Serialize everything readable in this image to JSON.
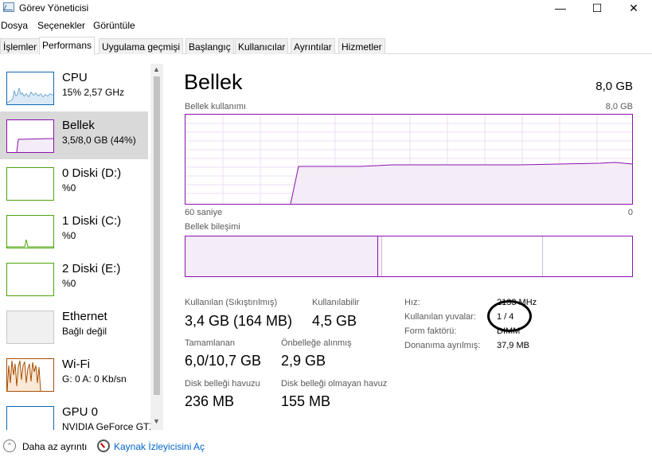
{
  "window": {
    "title": "Görev Yöneticisi",
    "icon": "task-manager-icon",
    "controls": {
      "minimize": "—",
      "maximize": "☐",
      "close": "✕"
    }
  },
  "menu": [
    "Dosya",
    "Seçenekler",
    "Görüntüle"
  ],
  "tabs": [
    "İşlemler",
    "Performans",
    "Uygulama geçmişi",
    "Başlangıç",
    "Kullanıcılar",
    "Ayrıntılar",
    "Hizmetler"
  ],
  "active_tab": "Performans",
  "sidebar": [
    {
      "name": "CPU",
      "sub": "15%  2,57 GHz",
      "color": "#1167b1"
    },
    {
      "name": "Bellek",
      "sub": "3,5/8,0 GB (44%)",
      "color": "#8b12ae"
    },
    {
      "name": "0 Diski (D:)",
      "sub": "%0",
      "color": "#4da60c"
    },
    {
      "name": "1 Diski (C:)",
      "sub": "%0",
      "color": "#4da60c"
    },
    {
      "name": "2 Diski (E:)",
      "sub": "%0",
      "color": "#4da60c"
    },
    {
      "name": "Ethernet",
      "sub": "Bağlı değil",
      "color": "#c0c0c0"
    },
    {
      "name": "Wi-Fi",
      "sub": "G: 0 A: 0 Kb/sn",
      "color": "#a74f01"
    },
    {
      "name": "GPU 0",
      "sub": "NVIDIA GeForce GTX",
      "color": "#1167b1"
    }
  ],
  "main": {
    "title": "Bellek",
    "total": "8,0 GB",
    "usage_label": "Bellek kullanımı",
    "usage_max": "8,0 GB",
    "time_left": "60 saniye",
    "time_right": "0",
    "composition_label": "Bellek bileşimi",
    "accent": "#8b12ae",
    "usage_fraction": 0.44
  },
  "stats": {
    "used_label": "Kullanılan (Sıkıştırılmış)",
    "used_val": "3,4 GB (164 MB)",
    "avail_label": "Kullanılabilir",
    "avail_val": "4,5 GB",
    "commit_label": "Tamamlanan",
    "commit_val": "6,0/10,7 GB",
    "cached_label": "Önbelleğe alınmış",
    "cached_val": "2,9 GB",
    "paged_label": "Disk belleği havuzu",
    "paged_val": "236 MB",
    "nonpaged_label": "Disk belleği olmayan havuz",
    "nonpaged_val": "155 MB"
  },
  "details": [
    {
      "label": "Hız:",
      "value": "2133 MHz"
    },
    {
      "label": "Kullanılan yuvalar:",
      "value": "1 / 4"
    },
    {
      "label": "Form faktörü:",
      "value": "DIMM"
    },
    {
      "label": "Donanıma ayrılmış:",
      "value": "37,9 MB"
    }
  ],
  "bottom": {
    "less_details": "Daha az ayrıntı",
    "resource_monitor": "Kaynak İzleyicisini Aç"
  }
}
